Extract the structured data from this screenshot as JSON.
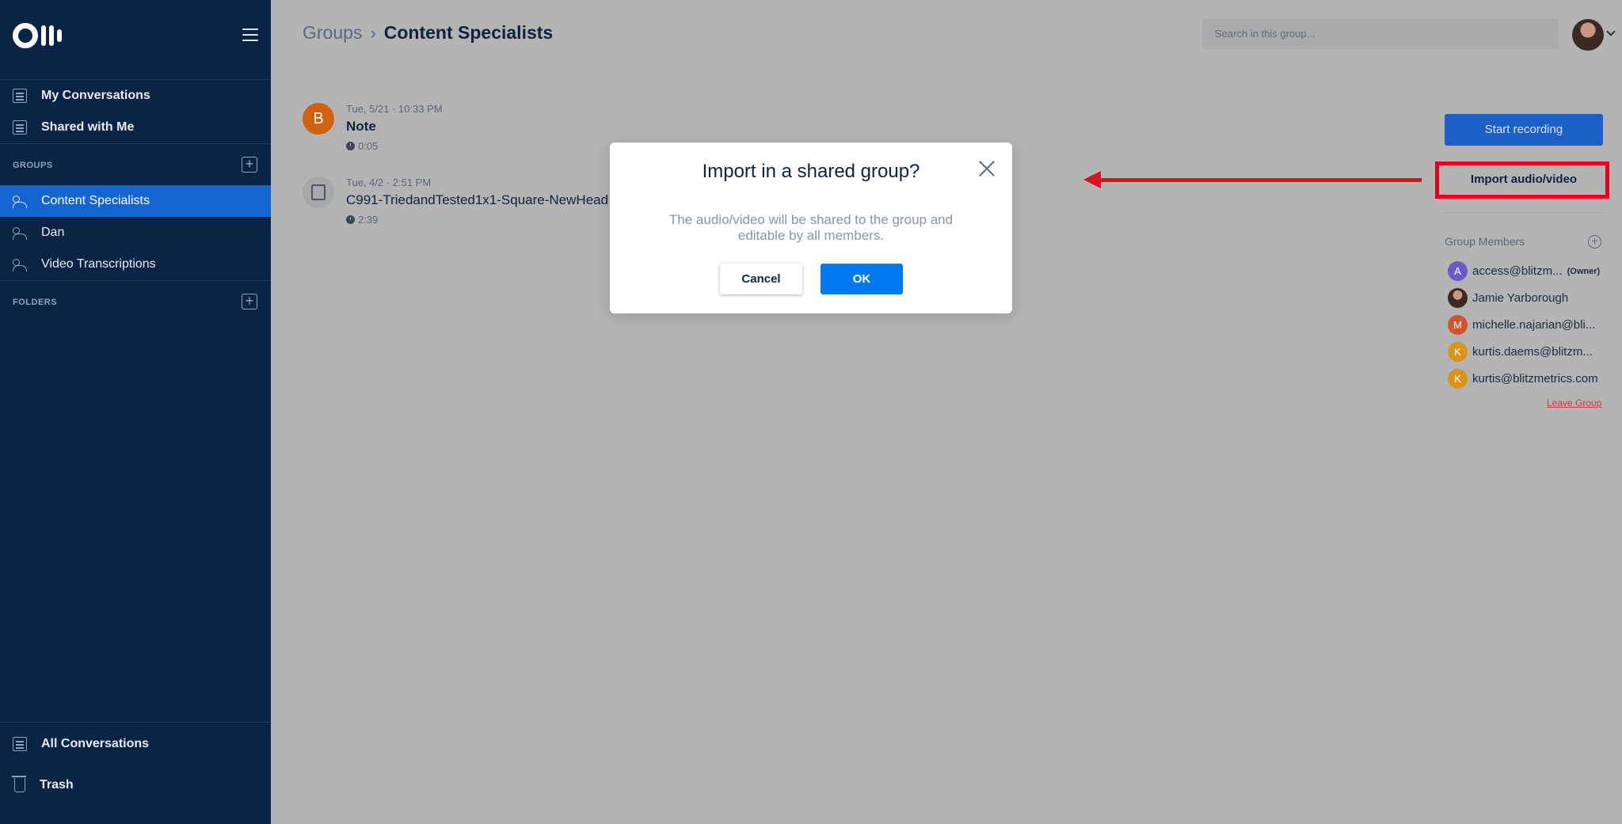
{
  "sidebar": {
    "nav": [
      {
        "label": "My Conversations"
      },
      {
        "label": "Shared with Me"
      }
    ],
    "groups_heading": "GROUPS",
    "groups": [
      {
        "label": "Content Specialists",
        "active": true
      },
      {
        "label": "Dan",
        "active": false
      },
      {
        "label": "Video Transcriptions",
        "active": false
      }
    ],
    "folders_heading": "FOLDERS",
    "bottom": [
      {
        "label": "All Conversations"
      },
      {
        "label": "Trash"
      }
    ]
  },
  "header": {
    "breadcrumb_root": "Groups",
    "breadcrumb_sep": "›",
    "breadcrumb_current": "Content Specialists",
    "search_placeholder": "Search in this group..."
  },
  "conversations": [
    {
      "avatar_letter": "B",
      "avatar_color": "#d1600f",
      "meta": "Tue, 5/21 · 10:33 PM",
      "title": "Note",
      "duration": "0:05"
    },
    {
      "avatar_letter": "",
      "avatar_color": "#a8a8a8",
      "meta": "Tue, 4/2 · 2:51 PM",
      "title": "C991-TriedandTested1x1-Square-NewHead",
      "duration": "2:39"
    }
  ],
  "right_panel": {
    "start_recording": "Start recording",
    "import_label": "Import audio/video",
    "members_title": "Group Members",
    "members": [
      {
        "letter": "A",
        "color": "#6c5bc5",
        "name": "access@blitzm...",
        "badge": "(Owner)"
      },
      {
        "letter": "",
        "color": "#3b2a24",
        "name": "Jamie Yarborough",
        "badge": ""
      },
      {
        "letter": "M",
        "color": "#d2532e",
        "name": "michelle.najarian@bli...",
        "badge": ""
      },
      {
        "letter": "K",
        "color": "#d9941c",
        "name": "kurtis.daems@blitzm...",
        "badge": ""
      },
      {
        "letter": "K",
        "color": "#d9941c",
        "name": "kurtis@blitzmetrics.com",
        "badge": ""
      }
    ],
    "leave_group": "Leave Group"
  },
  "modal": {
    "title": "Import in a shared group?",
    "body": "The audio/video will be shared to the group and editable by all members.",
    "cancel_label": "Cancel",
    "ok_label": "OK"
  },
  "colors": {
    "sidebar_bg": "#0b2446",
    "active_item": "#1565d0",
    "primary_button": "#0078f0",
    "annotation_red": "#e3001b"
  }
}
